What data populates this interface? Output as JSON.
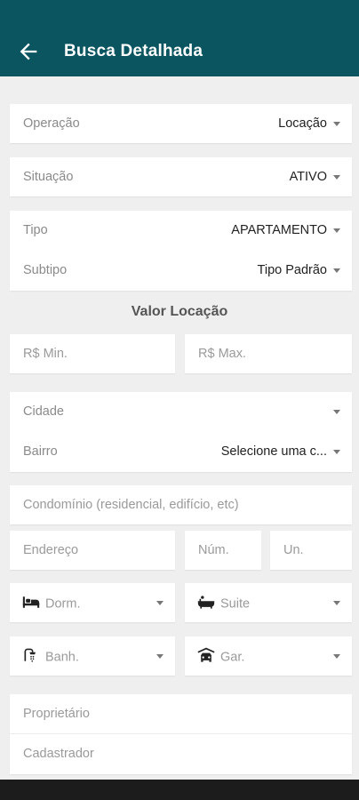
{
  "header": {
    "title": "Busca Detalhada",
    "back_icon": "arrow-left-icon",
    "background": "#0b5560"
  },
  "operacao": {
    "label": "Operação",
    "value": "Locação"
  },
  "situacao": {
    "label": "Situação",
    "value": "ATIVO"
  },
  "tipo": {
    "label": "Tipo",
    "value": "APARTAMENTO"
  },
  "subtipo": {
    "label": "Subtipo",
    "value": "Tipo Padrão"
  },
  "valor": {
    "title": "Valor Locação",
    "min_placeholder": "R$ Min.",
    "max_placeholder": "R$ Max."
  },
  "cidade": {
    "label": "Cidade",
    "value": ""
  },
  "bairro": {
    "label": "Bairro",
    "value": "Selecione uma c..."
  },
  "condominio": {
    "placeholder": "Condomínio (residencial, edifício, etc)"
  },
  "endereco": {
    "placeholder": "Endereço",
    "num_placeholder": "Núm.",
    "un_placeholder": "Un."
  },
  "dorm": {
    "placeholder": "Dorm.",
    "icon": "bed-icon"
  },
  "suite": {
    "placeholder": "Suite",
    "icon": "bathtub-icon"
  },
  "banh": {
    "placeholder": "Banh.",
    "icon": "shower-icon"
  },
  "gar": {
    "placeholder": "Gar.",
    "icon": "car-icon"
  },
  "proprietario": {
    "placeholder": "Proprietário"
  },
  "cadastrador": {
    "placeholder": "Cadastrador"
  }
}
